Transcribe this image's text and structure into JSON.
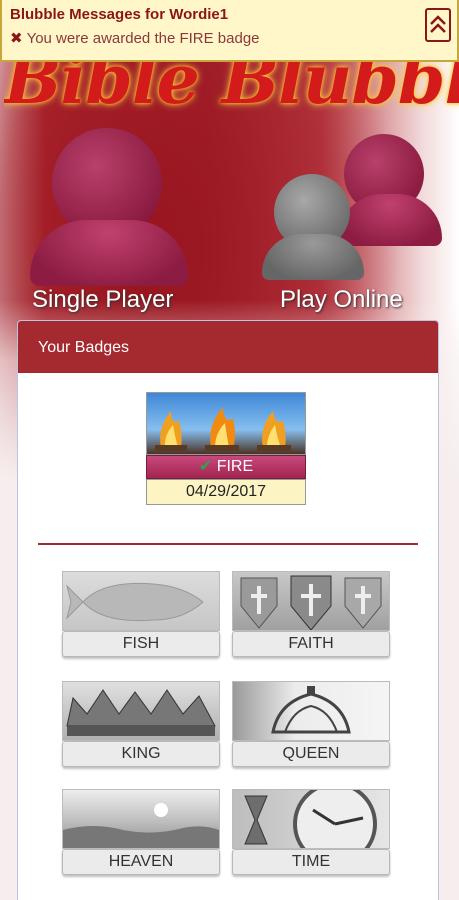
{
  "notification": {
    "title": "Blubble Messages for Wordie1",
    "close_glyph": "✖",
    "message": "You were awarded the FIRE badge",
    "collapse_icon": "double-chevron-up-icon"
  },
  "app": {
    "logo_text": "Bible Blubble"
  },
  "modes": {
    "single_label": "Single Player",
    "online_label": "Play Online"
  },
  "badges_panel": {
    "title": "Your Badges",
    "featured": {
      "name": "FIRE",
      "date": "04/29/2017",
      "check_glyph": "✔"
    },
    "badges": [
      {
        "name": "FISH"
      },
      {
        "name": "FAITH"
      },
      {
        "name": "KING"
      },
      {
        "name": "QUEEN"
      },
      {
        "name": "HEAVEN"
      },
      {
        "name": "TIME"
      }
    ]
  },
  "colors": {
    "accent": "#a52a2f",
    "notify_bg": "#fff6c9",
    "figure_maroon": "#9c2346",
    "figure_gray": "#7a7a7a"
  }
}
